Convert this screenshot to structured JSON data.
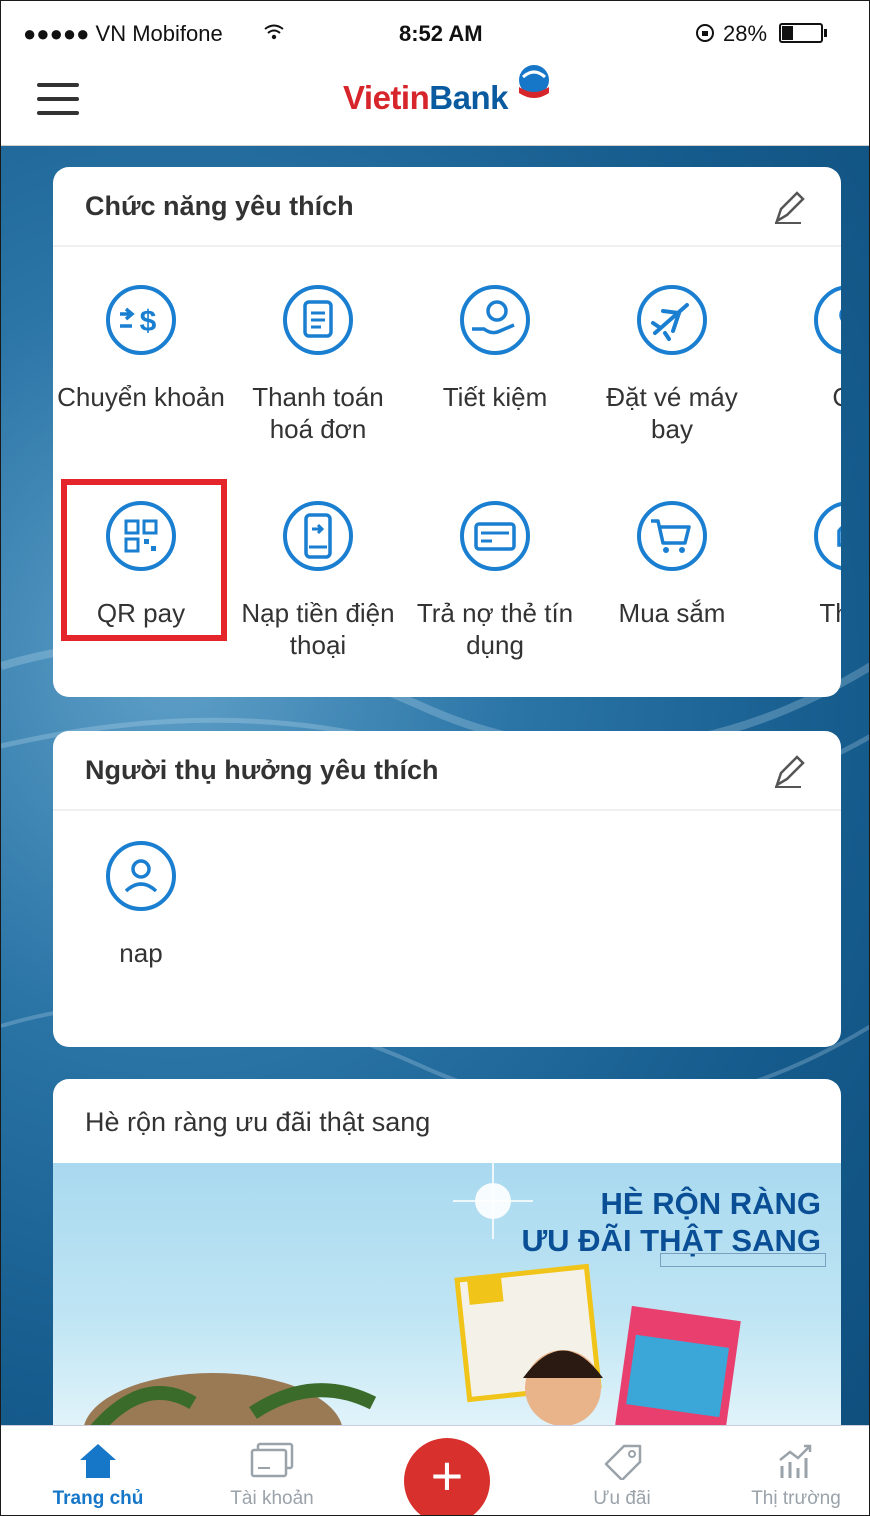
{
  "status_bar": {
    "carrier": "●●●●● VN Mobifone",
    "time": "8:52 AM",
    "battery": "28%"
  },
  "header": {
    "logo_part1": "Vietin",
    "logo_part2": "Bank"
  },
  "favorites": {
    "title": "Chức năng yêu thích",
    "row1": [
      {
        "icon": "transfer-icon",
        "label": "Chuyển khoản"
      },
      {
        "icon": "bill-icon",
        "label": "Thanh toán hoá đơn"
      },
      {
        "icon": "savings-icon",
        "label": "Tiết kiệm"
      },
      {
        "icon": "airplane-icon",
        "label": "Đặt vé máy bay"
      },
      {
        "icon": "location-icon",
        "label": "Cà"
      }
    ],
    "row2": [
      {
        "icon": "qr-icon",
        "label": "QR pay"
      },
      {
        "icon": "phone-topup-icon",
        "label": "Nạp tiền điện thoại"
      },
      {
        "icon": "credit-card-icon",
        "label": "Trả nợ thẻ tín dụng"
      },
      {
        "icon": "shopping-cart-icon",
        "label": "Mua sắm"
      },
      {
        "icon": "notification-icon",
        "label": "Thôn"
      }
    ]
  },
  "beneficiaries": {
    "title": "Người thụ hưởng yêu thích",
    "items": [
      {
        "name": "nap"
      }
    ]
  },
  "promo": {
    "title": "Hè rộn ràng ưu đãi thật sang",
    "banner_line1": "HÈ RỘN RÀNG",
    "banner_line2": "ƯU ĐÃI THẬT SANG"
  },
  "tabbar": {
    "items": [
      {
        "label": "Trang chủ",
        "active": true
      },
      {
        "label": "Tài khoản",
        "active": false
      },
      {
        "label": "+",
        "active": false
      },
      {
        "label": "Ưu đãi",
        "active": false
      },
      {
        "label": "Thị trường",
        "active": false
      }
    ]
  },
  "colors": {
    "brand_blue": "#1677c9",
    "brand_red": "#d7262b",
    "icon_blue": "#1a7fd0",
    "highlight": "#e4262c"
  }
}
